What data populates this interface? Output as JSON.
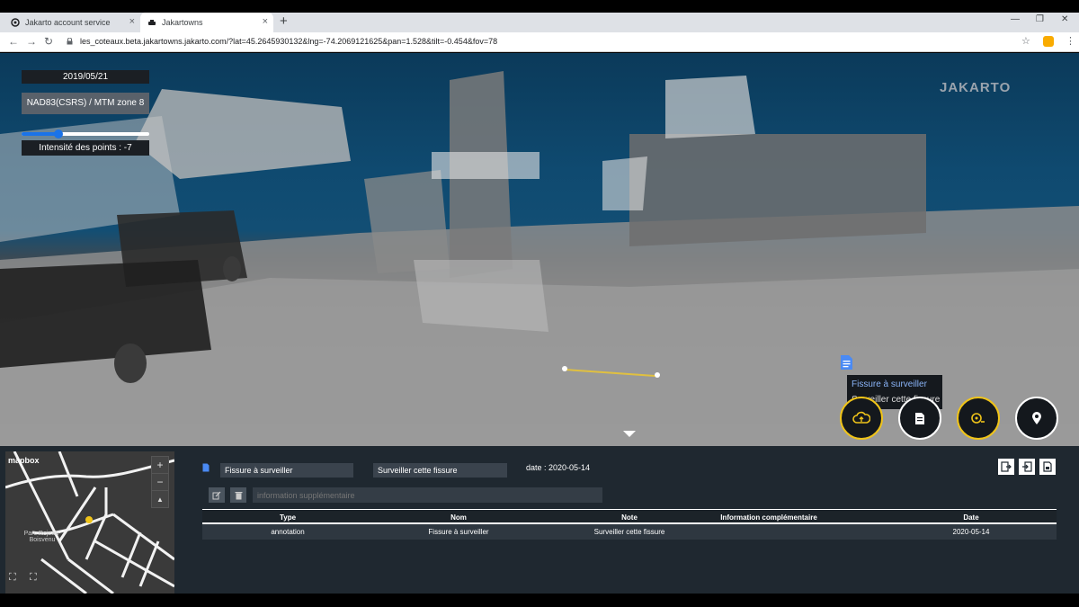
{
  "browser": {
    "tabs": [
      {
        "title": "Jakarto account service"
      },
      {
        "title": "Jakartowns"
      }
    ],
    "new_tab": "+",
    "url": "les_coteaux.beta.jakartowns.jakarto.com/?lat=45.2645930132&lng=-74.2069121625&pan=1.528&tilt=-0.454&fov=78"
  },
  "viewer": {
    "date": "2019/05/21",
    "crs": "NAD83(CSRS) / MTM zone 8",
    "intensity_label": "Intensité des points : -7",
    "intensity_value": -7,
    "logo": "JAKARTO",
    "annotation_tip": {
      "title": "Fissure à surveiller",
      "note": "Surveiller cette fissure"
    }
  },
  "map": {
    "attribution": "mapbox",
    "zoom_in": "+",
    "zoom_out": "−",
    "compass": "▲",
    "label": "Parc Rejean-Boisvenu"
  },
  "annotation_form": {
    "name": "Fissure à surveiller",
    "note": "Surveiller cette fissure",
    "date": "date : 2020-05-14",
    "info_placeholder": "information supplémentaire"
  },
  "table": {
    "headers": [
      "Type",
      "Nom",
      "Note",
      "Information complémentaire",
      "Date"
    ],
    "rows": [
      [
        "annotation",
        "Fissure à surveiller",
        "Surveiller cette fissure",
        "",
        "2020-05-14"
      ]
    ]
  },
  "colors": {
    "accent": "#1a73e8",
    "highlight": "#f0c419",
    "panel": "#1f2830"
  }
}
